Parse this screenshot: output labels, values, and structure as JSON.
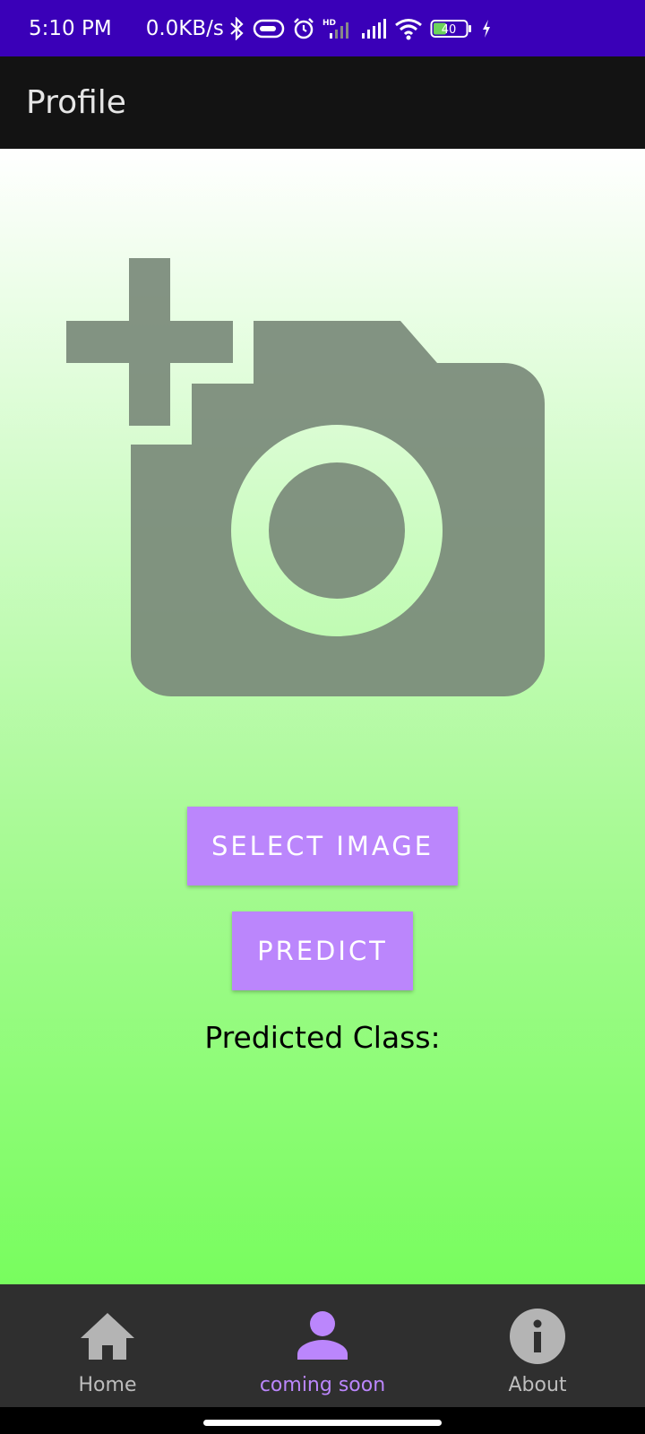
{
  "status_bar": {
    "time": "5:10 PM",
    "network_speed": "0.0KB/s",
    "battery_level": "40",
    "icons": [
      "bluetooth-icon",
      "vpn-key-icon",
      "alarm-icon",
      "hd-signal-icon",
      "signal-icon",
      "wifi-icon",
      "battery-icon",
      "charging-icon"
    ]
  },
  "app_bar": {
    "title": "Profile"
  },
  "main": {
    "image_placeholder_icon": "add-a-photo-icon",
    "select_image_label": "SELECT IMAGE",
    "predict_label": "PREDICT",
    "predicted_class_label": "Predicted Class:"
  },
  "bottom_nav": {
    "items": [
      {
        "label": "Home",
        "icon": "home-icon",
        "active": false
      },
      {
        "label": "coming soon",
        "icon": "person-icon",
        "active": true
      },
      {
        "label": "About",
        "icon": "info-icon",
        "active": false
      }
    ]
  },
  "colors": {
    "status_bar": "#3a00b8",
    "app_bar": "#131313",
    "accent": "#bb86fc",
    "nav_background": "#2f2f2f",
    "gradient_top": "#ffffff",
    "gradient_bottom": "#78fd5e",
    "icon_gray": "#7a8a7a"
  }
}
